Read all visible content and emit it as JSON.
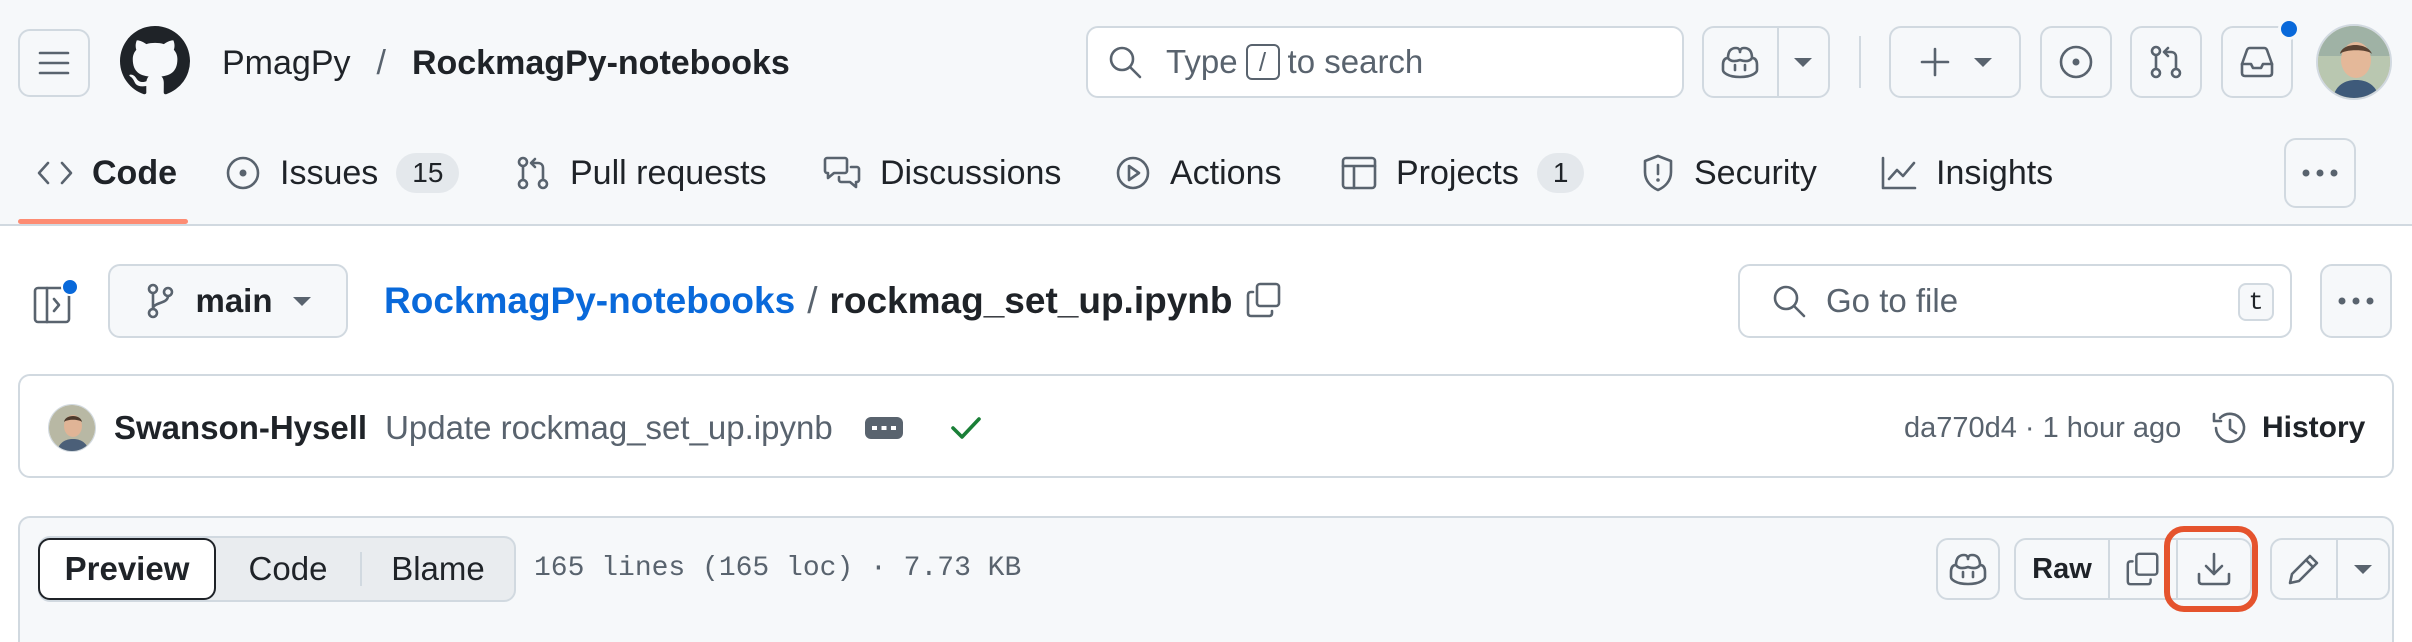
{
  "header": {
    "owner": "PmagPy",
    "separator": "/",
    "repo": "RockmagPy-notebooks",
    "search": {
      "prefix": "Type",
      "key": "/",
      "suffix": "to search"
    }
  },
  "nav": {
    "tabs": [
      {
        "label": "Code",
        "active": true
      },
      {
        "label": "Issues",
        "count": "15"
      },
      {
        "label": "Pull requests"
      },
      {
        "label": "Discussions"
      },
      {
        "label": "Actions"
      },
      {
        "label": "Projects",
        "count": "1"
      },
      {
        "label": "Security"
      },
      {
        "label": "Insights"
      }
    ]
  },
  "file": {
    "branch": "main",
    "repo_link": "RockmagPy-notebooks",
    "path_sep": "/",
    "filename": "rockmag_set_up.ipynb",
    "goto_placeholder": "Go to file",
    "goto_key": "t"
  },
  "commit": {
    "author": "Swanson-Hysell",
    "message": "Update rockmag_set_up.ipynb",
    "sha": "da770d4",
    "dot": "·",
    "time": "1 hour ago",
    "history_label": "History"
  },
  "viewer": {
    "modes": [
      "Preview",
      "Code",
      "Blame"
    ],
    "active_mode": "Preview",
    "stats": "165 lines (165 loc) · 7.73 KB",
    "raw_label": "Raw"
  },
  "colors": {
    "link": "#0969da",
    "success": "#1a7f37",
    "highlight": "#e5532d",
    "notification": "#0969da",
    "active_tab": "#fd8c73"
  }
}
